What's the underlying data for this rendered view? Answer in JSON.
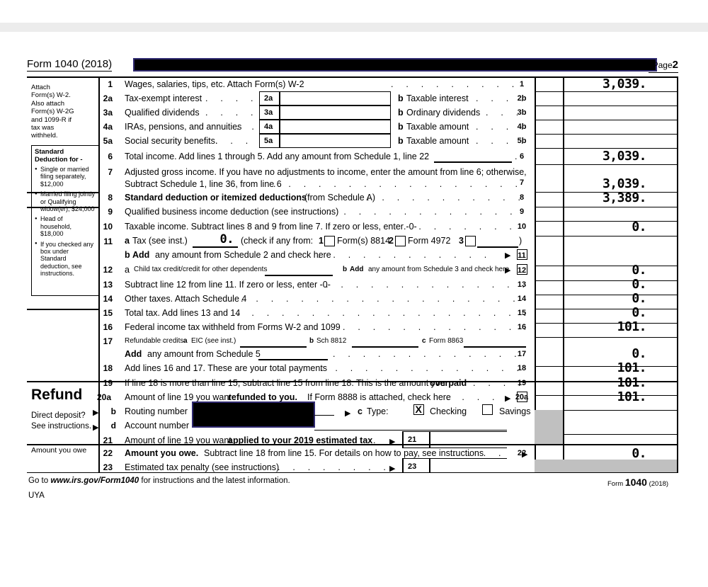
{
  "header": {
    "form_title": "Form 1040 (2018)",
    "page_label": "Page",
    "page_number": "2",
    "redacted_name": ""
  },
  "left_column": {
    "attach_note": "Attach Form(s) W-2. Also attach Form(s) W-2G and 1099-R if tax was withheld.",
    "standard_deduction": {
      "title": "Standard Deduction for -",
      "items": [
        "Single or married filing separately, $12,000",
        "Married filing jointly or Qualifying widow(er), $24,000",
        "Head of household, $18,000",
        "If you checked any box under Standard deduction, see instructions."
      ]
    },
    "refund_label": "Refund",
    "direct_deposit_note_1": "Direct deposit?",
    "direct_deposit_note_2": "See instructions.",
    "amount_you_owe_label": "Amount you owe"
  },
  "lines": [
    {
      "num": "1",
      "text": "Wages, salaries, tips, etc. Attach Form(s) W-2",
      "amount_num": "1",
      "amount": "3,039."
    },
    {
      "num": "2a",
      "text": "Tax-exempt interest",
      "sub_label": "2a",
      "sub_value": "",
      "b_label": "b",
      "b_text": "Taxable interest",
      "amount_num": "2b",
      "amount": ""
    },
    {
      "num": "3a",
      "text": "Qualified dividends",
      "sub_label": "3a",
      "sub_value": "",
      "b_label": "b",
      "b_text": "Ordinary dividends",
      "amount_num": "3b",
      "amount": ""
    },
    {
      "num": "4a",
      "text": "IRAs, pensions, and annuities",
      "sub_label": "4a",
      "sub_value": "",
      "b_label": "b",
      "b_text": "Taxable amount",
      "amount_num": "4b",
      "amount": ""
    },
    {
      "num": "5a",
      "text": "Social security benefits.",
      "sub_label": "5a",
      "sub_value": "",
      "b_label": "b",
      "b_text": "Taxable amount",
      "amount_num": "5b",
      "amount": ""
    },
    {
      "num": "6",
      "text": "Total income. Add lines 1 through 5. Add any amount from Schedule 1, line 22",
      "amount_num": "6",
      "amount": "3,039."
    },
    {
      "num": "7",
      "text": "Adjusted gross income. If you have no adjustments to income, enter the amount from line 6; otherwise,",
      "text2": "Subtract Schedule 1, line 36, from line 6",
      "amount_num": "7",
      "amount": "3,039."
    },
    {
      "num": "8",
      "text": "Standard deduction or itemized deductions",
      "text_suffix": "(from Schedule A)",
      "amount_num": "8",
      "amount": "3,389."
    },
    {
      "num": "9",
      "text": "Qualified business income deduction (see instructions)",
      "amount_num": "9",
      "amount": ""
    },
    {
      "num": "10",
      "text": "Taxable income. Subtract lines 8 and 9 from line 7. If zero or less, enter -0-",
      "amount_num": "10",
      "amount": "0."
    },
    {
      "num": "11",
      "text": "Tax (see inst.)",
      "a_label": "a",
      "tax_value": "0.",
      "check_text": "(check if any from:",
      "opt1_num": "1",
      "opt1": "Form(s) 8814",
      "opt2_num": "2",
      "opt2": "Form 4972",
      "opt3_num": "3",
      "close_paren": ")",
      "b_label": "b",
      "b_bold": "Add",
      "b_text": "any amount from Schedule 2 and check here",
      "amount_num": "11",
      "amount": ""
    },
    {
      "num": "12",
      "a_label": "a",
      "text": "Child tax credit/credit for other dependents",
      "b_label": "b",
      "b_bold": "Add",
      "b_text": "any amount from Schedule 3 and check here",
      "amount_num": "12",
      "amount": "0."
    },
    {
      "num": "13",
      "text": "Subtract line 12 from line 11. If zero or less, enter -0-",
      "amount_num": "13",
      "amount": "0."
    },
    {
      "num": "14",
      "text": "Other taxes. Attach Schedule 4",
      "amount_num": "14",
      "amount": "0."
    },
    {
      "num": "15",
      "text": "Total tax. Add lines 13 and 14",
      "amount_num": "15",
      "amount": "0."
    },
    {
      "num": "16",
      "text": "Federal income tax withheld from Forms W-2 and 1099",
      "amount_num": "16",
      "amount": "101."
    },
    {
      "num": "17",
      "text": "Refundable credits:",
      "a_label": "a",
      "a_text": "EIC (see inst.)",
      "b_label": "b",
      "b_text": "Sch 8812",
      "c_label": "c",
      "c_text": "Form 8863",
      "add_bold": "Add",
      "add_text": "any amount from Schedule 5",
      "amount_num": "17",
      "amount": "0."
    },
    {
      "num": "18",
      "text": "Add lines 16 and 17. These are your total payments",
      "amount_num": "18",
      "amount": "101."
    },
    {
      "num": "19",
      "text": "If line 18 is more than line 15, subtract line 15 from line 18. This is the amount you",
      "text_bold_suffix": "overpaid",
      "amount_num": "19",
      "amount": "101."
    },
    {
      "num": "20a",
      "text": "Amount of line 19 you want",
      "text_bold": "refunded to you.",
      "text2": "If Form 8888 is attached, check here",
      "amount_num": "20a",
      "amount": "101."
    },
    {
      "num": "b",
      "text": "Routing number",
      "type_label": "c",
      "type_text": "Type:",
      "checking_label": "Checking",
      "checking_checked": true,
      "savings_label": "Savings",
      "savings_checked": false
    },
    {
      "num": "d",
      "text": "Account number"
    },
    {
      "num": "21",
      "text": "Amount of line 19 you want",
      "text_bold": "applied to your 2019 estimated tax",
      "amount_num": "21",
      "amount": ""
    },
    {
      "num": "22",
      "text_bold": "Amount you owe.",
      "text": "Subtract line 18 from line 15. For details on how to pay, see instructions",
      "amount_num": "22",
      "amount": "0."
    },
    {
      "num": "23",
      "text": "Estimated tax penalty (see instructions)",
      "amount_num": "23",
      "amount": ""
    }
  ],
  "footer": {
    "goto_prefix": "Go to",
    "goto_url": "www.irs.gov/Form1040",
    "goto_suffix": "for instructions and the latest information.",
    "form_word": "Form",
    "form_number": "1040",
    "form_year": "(2018)",
    "preparer_code": "UYA"
  },
  "colors": {
    "redaction_fill": "#000000",
    "redaction_border": "#302a70",
    "shade_gray": "#c0c0c0",
    "band_gray": "#ececec"
  }
}
